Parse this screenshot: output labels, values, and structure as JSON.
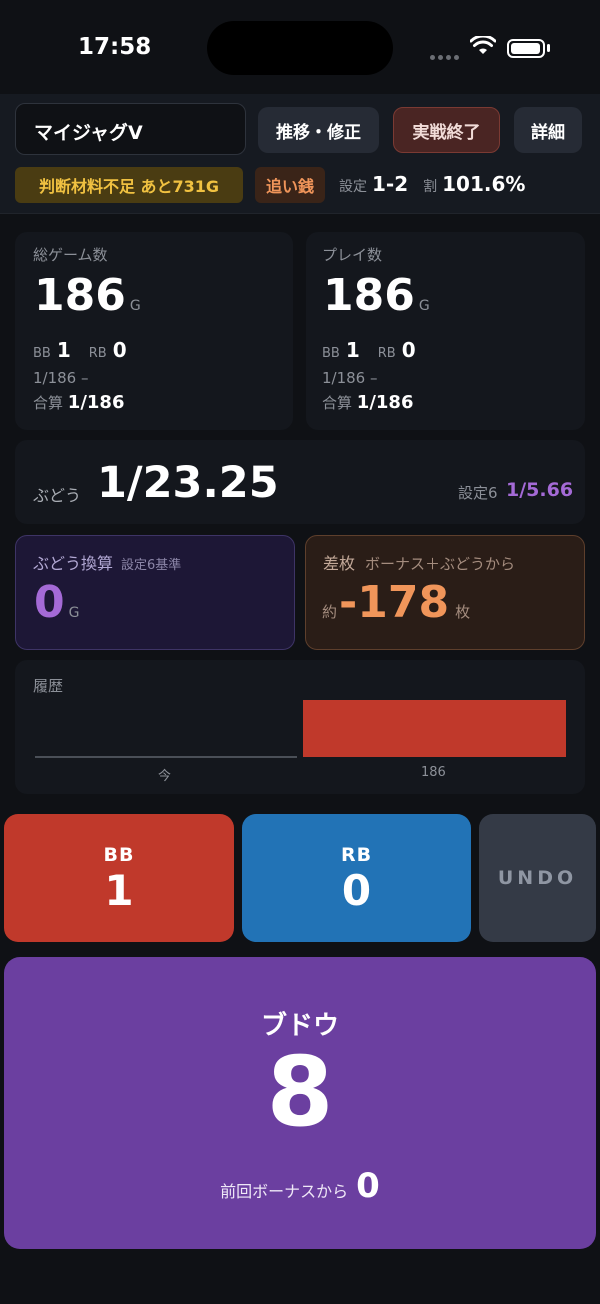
{
  "status": {
    "time": "17:58"
  },
  "header": {
    "machine_name": "マイジャグV",
    "trend_button": "推移・修正",
    "end_button": "実戦終了",
    "detail_button": "詳細",
    "insufficient_badge": "判断材料不足 あと731G",
    "chase_badge": "追い銭",
    "setting_label": "設定",
    "setting_value": "1-2",
    "rate_label": "割",
    "rate_value": "101.6%"
  },
  "total_games": {
    "label": "総ゲーム数",
    "value": "186",
    "unit": "G",
    "bb_label": "BB",
    "bb_value": "1",
    "rb_label": "RB",
    "rb_value": "0",
    "ratio": "1/186  –",
    "combined_label": "合算",
    "combined_value": "1/186"
  },
  "plays": {
    "label": "プレイ数",
    "value": "186",
    "unit": "G",
    "bb_label": "BB",
    "bb_value": "1",
    "rb_label": "RB",
    "rb_value": "0",
    "ratio": "1/186  –",
    "combined_label": "合算",
    "combined_value": "1/186"
  },
  "grape": {
    "label": "ぶどう",
    "value": "1/23.25",
    "s6_label": "設定6",
    "s6_value": "1/5.66"
  },
  "grape_conversion": {
    "label": "ぶどう換算",
    "sub_label": "設定6基準",
    "value": "0",
    "unit": "G"
  },
  "difference": {
    "label": "差枚",
    "sub_label": "ボーナス＋ぶどうから",
    "prefix": "約",
    "value": "-178",
    "unit": "枚"
  },
  "history": {
    "label": "履歴",
    "left_tick": "今",
    "right_tick": "186"
  },
  "buttons": {
    "bb_label": "BB",
    "bb_count": "1",
    "rb_label": "RB",
    "rb_count": "0",
    "undo_label": "UNDO",
    "grape_label": "ブドウ",
    "grape_count": "8",
    "since_label": "前回ボーナスから",
    "since_value": "0"
  },
  "colors": {
    "bb": "#c0392b",
    "rb": "#2273b6",
    "grape": "#6b3fa0",
    "difference": "#f0955a",
    "conversion": "#a46ad6"
  }
}
